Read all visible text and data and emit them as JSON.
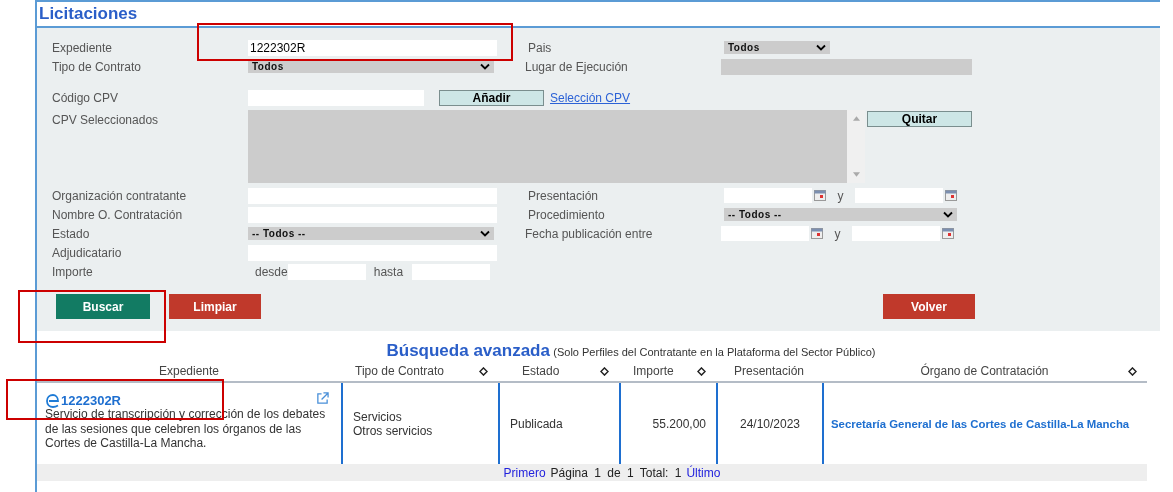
{
  "title": "Licitaciones",
  "form": {
    "expediente": {
      "label": "Expediente",
      "value": "1222302R"
    },
    "tipo_contrato": {
      "label": "Tipo de Contrato",
      "value": "Todos"
    },
    "pais": {
      "label": "Pais",
      "value": "Todos"
    },
    "lugar_ejecucion": {
      "label": "Lugar de Ejecución",
      "disabled": true
    },
    "codigo_cpv": {
      "label": "Código CPV",
      "add_button": "Añadir",
      "link": "Selección CPV"
    },
    "cpv_seleccionados": {
      "label": "CPV Seleccionados",
      "remove_button": "Quitar"
    },
    "organizacion": {
      "label": "Organización contratante"
    },
    "nombre_contratacion": {
      "label": "Nombre O. Contratación"
    },
    "estado": {
      "label": "Estado",
      "value": "-- Todos --"
    },
    "adjudicatario": {
      "label": "Adjudicatario"
    },
    "importe": {
      "label": "Importe",
      "from_label": "desde",
      "to_label": "hasta"
    },
    "presentacion": {
      "label": "Presentación",
      "joiner": "y"
    },
    "procedimiento": {
      "label": "Procedimiento",
      "value": "-- Todos --"
    },
    "fecha_publicacion": {
      "label": "Fecha publicación entre",
      "joiner": "y"
    }
  },
  "buttons": [
    {
      "label": "Buscar",
      "kind": "primary"
    },
    {
      "label": "Limpiar",
      "kind": "danger"
    },
    {
      "label": "Volver",
      "kind": "danger"
    }
  ],
  "results": {
    "heading": "Búsqueda avanzada",
    "subheading": "(Solo Perfiles del Contratante en la Plataforma del Sector Público)",
    "columns": [
      {
        "label": "Expediente",
        "sortable": false
      },
      {
        "label": "Tipo de Contrato",
        "sortable": true
      },
      {
        "label": "Estado",
        "sortable": true
      },
      {
        "label": "Importe",
        "sortable": true
      },
      {
        "label": "Presentación",
        "sortable": false
      },
      {
        "label": "Órgano de Contratación",
        "sortable": true
      }
    ],
    "rows": [
      {
        "expediente": "1222302R",
        "description": "Servicio de transcripción y corrección de los debates de las sesiones que celebren los órganos de las Cortes de Castilla-La Mancha.",
        "tipo": [
          "Servicios",
          "Otros servicios"
        ],
        "estado": "Publicada",
        "importe": "55.200,00",
        "presentacion": "24/10/2023",
        "organo": "Secretaría General de las Cortes de Castilla-La Mancha"
      }
    ],
    "pagination": {
      "first": "Primero",
      "summary": "Página 1 de 1 Total: 1",
      "last": "Último"
    }
  }
}
